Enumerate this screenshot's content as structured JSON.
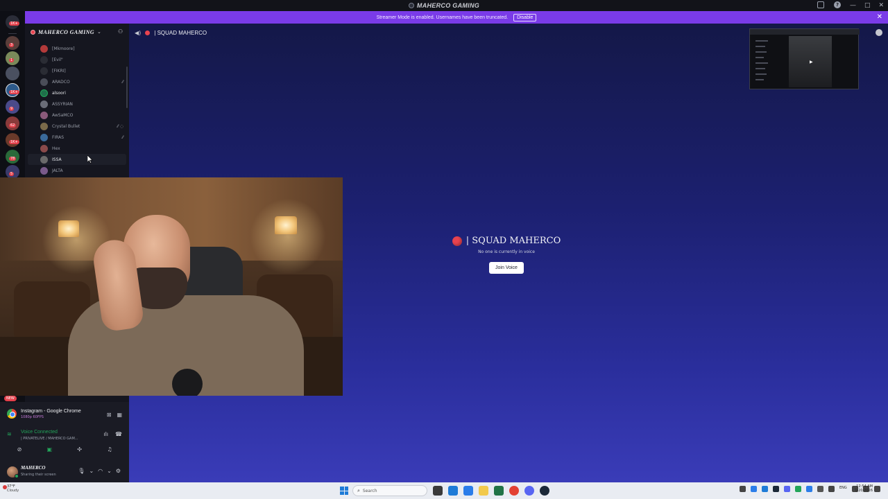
{
  "window": {
    "app_title": "MAHERCO GAMING",
    "controls": [
      "—",
      "□",
      "✕"
    ]
  },
  "banner": {
    "message": "Streamer Mode is enabled. Usernames have been truncated.",
    "disable_label": "Disable",
    "close": "✕",
    "color": "#7a3be8"
  },
  "rail": {
    "badges": [
      "1K+",
      "3",
      "1",
      "1K+",
      "9",
      "62",
      "1K+",
      "78",
      "5"
    ]
  },
  "server": {
    "name": "MAHERCO GAMING",
    "chevron": "⌄"
  },
  "members": [
    {
      "name": "[Mkmoore]",
      "bright": false,
      "avatar": "#b33a3a"
    },
    {
      "name": "[Evil\"",
      "bright": false,
      "avatar": "#2a2c34"
    },
    {
      "name": "[FIKRI]",
      "bright": false,
      "avatar": "#2a2c34"
    },
    {
      "name": "ARADCO",
      "bright": false,
      "avatar": "#4a4d58"
    },
    {
      "name": "alsoori",
      "bright": true,
      "avatar": "#1f6f4a"
    },
    {
      "name": "ASSYRIAN",
      "bright": false,
      "avatar": "#6a6d78"
    },
    {
      "name": "AwSaMCO",
      "bright": false,
      "avatar": "#8a5a7a"
    },
    {
      "name": "Crystal Bullet",
      "bright": false,
      "avatar": "#7a6a4a"
    },
    {
      "name": "FIRAS",
      "bright": false,
      "avatar": "#3a6a9a"
    },
    {
      "name": "Hex",
      "bright": false,
      "avatar": "#8a4a4a"
    },
    {
      "name": "ISSA",
      "bright": true,
      "avatar": "#6a6a6a"
    },
    {
      "name": "JALTA",
      "bright": false,
      "avatar": "#7a5a8a"
    }
  ],
  "channel": {
    "name": "| SQUAD MAHERCO",
    "dot_color": "#e8434f"
  },
  "voice_empty": {
    "title": "| SQUAD MAHERCO",
    "subtitle": "No one is currently in voice",
    "join_label": "Join Voice"
  },
  "panel": {
    "new_badge": "NEW",
    "stream_title": "Instagram - Google Chrome",
    "stream_sub": "1080p 60FPS",
    "voice_status": "Voice Connected",
    "voice_channel": "| PRIVATELIVE / MAHERCO GAM...",
    "user_name": "MAHERCO",
    "user_status": "Sharing their screen"
  },
  "taskbar": {
    "temp": "37°F",
    "condition": "Cloudy",
    "search_placeholder": "Search",
    "lang": "ENG",
    "time": "12:54 AM",
    "date": "1/20/2026"
  }
}
